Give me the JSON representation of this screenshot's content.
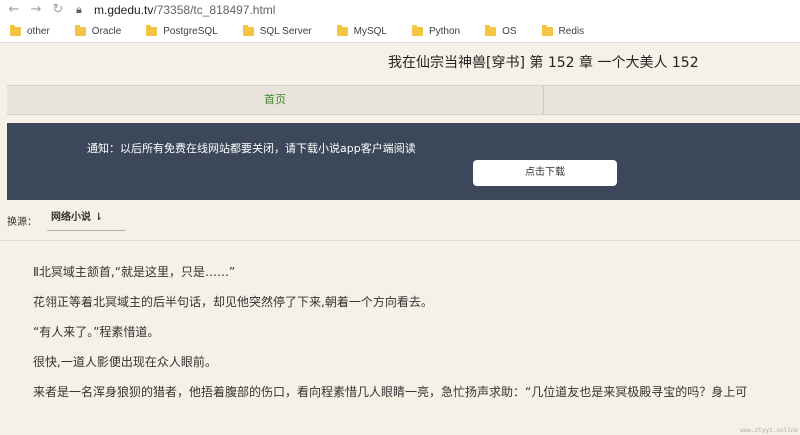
{
  "browser": {
    "back_icon": "back-arrow-icon",
    "forward_icon": "forward-arrow-icon",
    "reload_icon": "reload-icon",
    "url_host": "m.gdedu.tv",
    "url_path": "/73358/tc_818497.html",
    "bookmarks": [
      "other",
      "Oracle",
      "PostgreSQL",
      "SQL Server",
      "MySQL",
      "Python",
      "OS",
      "Redis"
    ]
  },
  "page": {
    "title": "我在仙宗当神兽[穿书] 第 152 章 一个大美人 152",
    "nav_home": "首页",
    "notice_text": "通知：以后所有免费在线网站都要关闭，请下载小说app客户端阅读",
    "download_button": "点击下载",
    "source_label": "换源：",
    "source_value": "网络小说 ⇂",
    "paragraphs": [
      "Ⅱ北冥域主颔首,“就是这里，只是……”",
      "花翎正等着北冥域主的后半句话，却见他突然停了下来,朝着一个方向看去。",
      "“有人来了。”程素惜道。",
      "很快,一道人影便出现在众人眼前。",
      "来者是一名浑身狼狈的猎者，他捂着腹部的伤口，看向程素惜几人眼睛一亮，急忙扬声求助：“几位道友也是来冥极殿寻宝的吗？身上可"
    ],
    "watermark": "www.ztyyz.online"
  },
  "colors": {
    "notice_bg": "#3c4759",
    "home_link": "#3a8a2e",
    "page_bg": "#f5f1e6"
  }
}
